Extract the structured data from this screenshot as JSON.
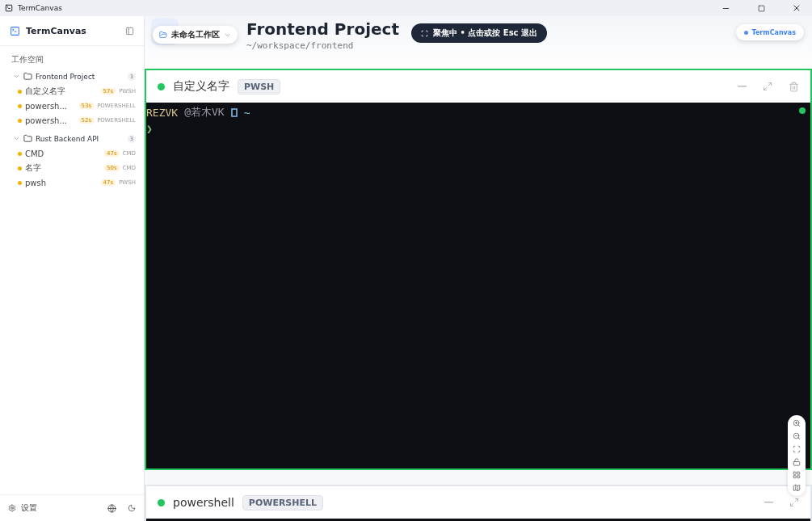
{
  "window": {
    "title": "TermCanvas"
  },
  "sidebar": {
    "brand": "TermCanvas",
    "section": "工作空间",
    "settings": "设置",
    "groups": [
      {
        "name": "Frontend Project",
        "count": "3",
        "expanded": true,
        "terminals": [
          {
            "name": "自定义名字",
            "age": "57s",
            "shell": "PWSH"
          },
          {
            "name": "powersh...",
            "age": "53s",
            "shell": "POWERSHELL"
          },
          {
            "name": "powersh...",
            "age": "52s",
            "shell": "POWERSHELL"
          }
        ]
      },
      {
        "name": "Rust Backend API",
        "count": "3",
        "expanded": true,
        "terminals": [
          {
            "name": "CMD",
            "age": "47s",
            "shell": "CMD"
          },
          {
            "name": "名字",
            "age": "50s",
            "shell": "CMD"
          },
          {
            "name": "pwsh",
            "age": "47s",
            "shell": "PWSH"
          }
        ]
      }
    ]
  },
  "header": {
    "workspace": "未命名工作区",
    "title": "Frontend Project",
    "path": "~/workspace/frontend",
    "focus_banner": "聚焦中 • 点击或按 Esc 退出",
    "app_badge": "TermCanvas"
  },
  "terminals": [
    {
      "title": "自定义名字",
      "shell": "PWSH",
      "focused": true,
      "lines": [
        [
          {
            "kind": "user",
            "text": "REZVK"
          },
          {
            "kind": "host",
            "text": "@若木VK"
          },
          {
            "kind": "folder"
          },
          {
            "kind": "path",
            "text": "~"
          }
        ],
        [
          {
            "kind": "prompt",
            "text": "❯"
          }
        ]
      ]
    },
    {
      "title": "powershell",
      "shell": "POWERSHELL",
      "focused": false
    }
  ]
}
